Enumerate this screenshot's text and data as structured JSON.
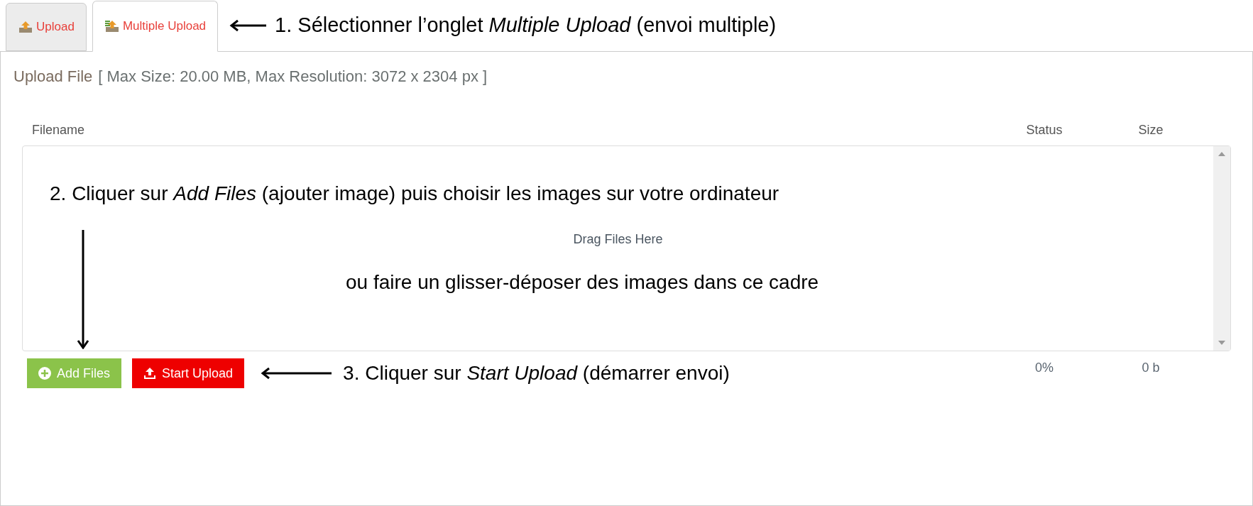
{
  "tabs": [
    {
      "label": "Upload",
      "selected": false
    },
    {
      "label": "Multiple Upload",
      "selected": true
    }
  ],
  "upload_info": {
    "title": "Upload File",
    "limits": "[ Max Size: 20.00 MB, Max Resolution: 3072 x 2304 px ]"
  },
  "table": {
    "columns": [
      "Filename",
      "Status",
      "Size"
    ],
    "drop_hint": "Drag Files Here",
    "totals": {
      "status": "0%",
      "size": "0 b"
    }
  },
  "buttons": [
    {
      "label": "Add Files",
      "kind": "add"
    },
    {
      "label": "Start Upload",
      "kind": "start"
    }
  ],
  "annotations": [
    {
      "text": "1. Sélectionner l’onglet *Multiple Upload* (envoi multiple)"
    },
    {
      "text": "2. Cliquer sur *Add Files* (ajouter image) puis choisir les images sur votre ordinateur"
    },
    {
      "text": "ou faire un glisser-déposer des images dans ce cadre"
    },
    {
      "text": "3. Cliquer sur *Start Upload* (démarrer envoi)"
    }
  ]
}
